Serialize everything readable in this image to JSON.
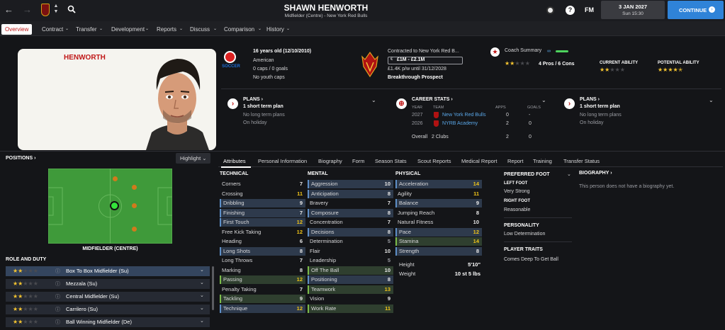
{
  "header": {
    "player_name": "SHAWN HENWORTH",
    "subtitle": "Midfielder (Centre) - New York Red Bulls",
    "date": "3 JAN 2027",
    "day_time": "Sun 15:30",
    "continue_label": "CONTINUE",
    "fm_label": "FM"
  },
  "tabs": [
    "Overview",
    "Contract",
    "Transfer",
    "Development",
    "Reports",
    "Discuss",
    "Comparison",
    "History"
  ],
  "profile": {
    "surname": "HENWORTH",
    "age": "16 years old (12/10/2010)",
    "nationality": "American",
    "caps": "0 caps / 0 goals",
    "youth_caps": "No youth caps",
    "contract_line": "Contracted to New York Red B...",
    "value": "£1M - £2.1M",
    "wage": "£1.4K p/w until 31/12/2028",
    "prospect": "Breakthrough Prospect",
    "coach_summary_label": "Coach Summary",
    "pros_cons": "4 Pros / 6 Cons",
    "ca_label": "CURRENT ABILITY",
    "pa_label": "POTENTIAL ABILITY",
    "ca_stars": 2,
    "pa_stars": 4.5,
    "summary_stars": 2
  },
  "plans_left": {
    "title": "PLANS",
    "line1": "1 short term plan",
    "line2": "No long term plans",
    "line3": "On holiday"
  },
  "plans_right": {
    "title": "PLANS",
    "line1": "1 short term plan",
    "line2": "No long term plans",
    "line3": "On holiday"
  },
  "career": {
    "title": "CAREER STATS",
    "col_year": "YEAR",
    "col_team": "TEAM",
    "col_apps": "APPS",
    "col_goals": "GOALS",
    "rows": [
      {
        "year": "2027",
        "team": "New York Red Bulls",
        "apps": "0",
        "goals": "-"
      },
      {
        "year": "2026",
        "team": "NYRB Academy",
        "apps": "2",
        "goals": "0"
      }
    ],
    "overall_label": "Overall",
    "overall_clubs": "2 Clubs",
    "overall_apps": "2",
    "overall_goals": "0"
  },
  "positions": {
    "title": "POSITIONS",
    "highlight_label": "Highlight",
    "position_name": "MIDFIELDER (CENTRE)"
  },
  "role_duty": {
    "title": "ROLE AND DUTY",
    "roles": [
      {
        "name": "Box To Box Midfielder (Su)",
        "stars": 2
      },
      {
        "name": "Mezzala (Su)",
        "stars": 2
      },
      {
        "name": "Central Midfielder (Su)",
        "stars": 2
      },
      {
        "name": "Carrilero (Su)",
        "stars": 2
      },
      {
        "name": "Ball Winning Midfielder (De)",
        "stars": 2
      }
    ]
  },
  "subtabs": [
    "Attributes",
    "Personal Information",
    "Biography",
    "Form",
    "Season Stats",
    "Scout Reports",
    "Medical Report",
    "Report",
    "Training",
    "Transfer Status"
  ],
  "attributes": {
    "technical_title": "TECHNICAL",
    "mental_title": "MENTAL",
    "physical_title": "PHYSICAL",
    "technical": [
      {
        "name": "Corners",
        "value": "7",
        "hl": "",
        "col": "g"
      },
      {
        "name": "Crossing",
        "value": "11",
        "hl": "",
        "col": "y"
      },
      {
        "name": "Dribbling",
        "value": "9",
        "hl": "blue",
        "col": "g"
      },
      {
        "name": "Finishing",
        "value": "7",
        "hl": "blue",
        "col": "g"
      },
      {
        "name": "First Touch",
        "value": "12",
        "hl": "blue",
        "col": "y"
      },
      {
        "name": "Free Kick Taking",
        "value": "12",
        "hl": "",
        "col": "y"
      },
      {
        "name": "Heading",
        "value": "6",
        "hl": "",
        "col": "g"
      },
      {
        "name": "Long Shots",
        "value": "8",
        "hl": "blue",
        "col": "g"
      },
      {
        "name": "Long Throws",
        "value": "7",
        "hl": "",
        "col": "g"
      },
      {
        "name": "Marking",
        "value": "8",
        "hl": "",
        "col": "g"
      },
      {
        "name": "Passing",
        "value": "12",
        "hl": "green",
        "col": "y"
      },
      {
        "name": "Penalty Taking",
        "value": "7",
        "hl": "",
        "col": "g"
      },
      {
        "name": "Tackling",
        "value": "9",
        "hl": "green",
        "col": "g"
      },
      {
        "name": "Technique",
        "value": "12",
        "hl": "blue",
        "col": "y"
      }
    ],
    "mental": [
      {
        "name": "Aggression",
        "value": "10",
        "hl": "blue",
        "col": "g"
      },
      {
        "name": "Anticipation",
        "value": "8",
        "hl": "blue",
        "col": "g"
      },
      {
        "name": "Bravery",
        "value": "7",
        "hl": "",
        "col": "g"
      },
      {
        "name": "Composure",
        "value": "8",
        "hl": "blue",
        "col": "g"
      },
      {
        "name": "Concentration",
        "value": "7",
        "hl": "",
        "col": "g"
      },
      {
        "name": "Decisions",
        "value": "8",
        "hl": "blue",
        "col": "g"
      },
      {
        "name": "Determination",
        "value": "5",
        "hl": "",
        "col": "gray"
      },
      {
        "name": "Flair",
        "value": "10",
        "hl": "",
        "col": "g"
      },
      {
        "name": "Leadership",
        "value": "5",
        "hl": "",
        "col": "gray"
      },
      {
        "name": "Off The Ball",
        "value": "10",
        "hl": "green",
        "col": "g"
      },
      {
        "name": "Positioning",
        "value": "8",
        "hl": "blue",
        "col": "g"
      },
      {
        "name": "Teamwork",
        "value": "13",
        "hl": "green",
        "col": "y"
      },
      {
        "name": "Vision",
        "value": "9",
        "hl": "",
        "col": "g"
      },
      {
        "name": "Work Rate",
        "value": "11",
        "hl": "green",
        "col": "y"
      }
    ],
    "physical": [
      {
        "name": "Acceleration",
        "value": "14",
        "hl": "blue",
        "col": "y"
      },
      {
        "name": "Agility",
        "value": "11",
        "hl": "",
        "col": "y"
      },
      {
        "name": "Balance",
        "value": "9",
        "hl": "blue",
        "col": "g"
      },
      {
        "name": "Jumping Reach",
        "value": "8",
        "hl": "",
        "col": "g"
      },
      {
        "name": "Natural Fitness",
        "value": "10",
        "hl": "",
        "col": "g"
      },
      {
        "name": "Pace",
        "value": "12",
        "hl": "blue",
        "col": "y"
      },
      {
        "name": "Stamina",
        "value": "14",
        "hl": "green",
        "col": "y"
      },
      {
        "name": "Strength",
        "value": "8",
        "hl": "blue",
        "col": "g"
      }
    ],
    "height_label": "Height",
    "height": "5'10\"",
    "weight_label": "Weight",
    "weight": "10 st 5 lbs"
  },
  "details": {
    "preferred_foot_title": "PREFERRED FOOT",
    "left_foot_label": "LEFT FOOT",
    "left_foot": "Very Strong",
    "right_foot_label": "RIGHT FOOT",
    "right_foot": "Reasonable",
    "personality_title": "PERSONALITY",
    "personality": "Low Determination",
    "traits_title": "PLAYER TRAITS",
    "trait1": "Comes Deep To Get Ball",
    "bio_title": "BIOGRAPHY",
    "bio_text": "This person does not have a biography yet."
  },
  "colors": {
    "accent_red": "#c01818",
    "continue_blue": "#2f83d8",
    "star": "#f4c430",
    "pitch": "#3f9a3a"
  }
}
